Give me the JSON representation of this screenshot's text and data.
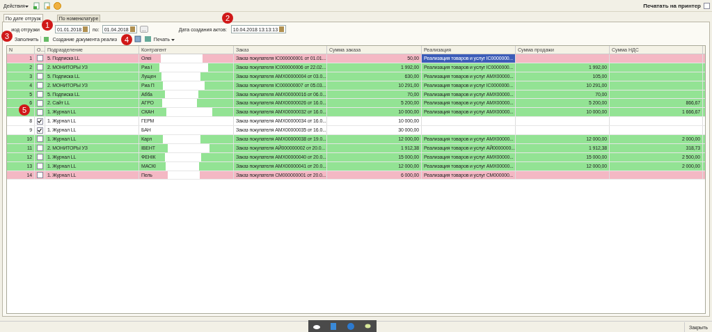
{
  "toolbar": {
    "menu": "Действия",
    "print_checkbox": {
      "label": "Печатать на принтер",
      "checked": false
    }
  },
  "tabs": [
    {
      "label": "По дате отгрузк",
      "selected": true
    },
    {
      "label": "По номенклатуре",
      "selected": false
    }
  ],
  "period": {
    "label": "иод отгрузки",
    "from": "01.01.2018",
    "to_label": "по:",
    "to": "01.04.2018",
    "button": "..."
  },
  "acts_date": {
    "label": "Дата создания актов:",
    "value": "10.04.2018 13:13:13"
  },
  "commands": [
    {
      "kind": "fill",
      "label": "Заполнить"
    },
    {
      "kind": "create",
      "label": "Создание документа реализ"
    },
    {
      "kind": "print",
      "label": "Печать"
    }
  ],
  "table": {
    "columns": [
      "N",
      "О...",
      "Подразделение",
      "Контрагент",
      "Заказ",
      "Сумма заказа",
      "Реализация",
      "Сумма продажи",
      "Сумма НДС"
    ],
    "rows": [
      {
        "n": "1",
        "checked": false,
        "selected": true,
        "color": "#f4b8c4",
        "division": "5. Подписка LL",
        "counterparty": "Олеі",
        "order": "Заказ покупателя IC000000001 от 01.01...",
        "order_sum": "50,00",
        "realization": "Реализация товаров и услуг IC0000000...",
        "sale_sum": "",
        "vat": ""
      },
      {
        "n": "2",
        "checked": false,
        "selected": false,
        "color": "#93e394",
        "division": "2. МОНИТОРЫ УЗ",
        "counterparty": "Риа І",
        "order": "Заказ покупателя IC000000006 от 22.02...",
        "order_sum": "1 992,00",
        "realization": "Реализация товаров и услуг IC0000000...",
        "sale_sum": "1 992,00",
        "vat": ""
      },
      {
        "n": "3",
        "checked": false,
        "selected": false,
        "color": "#93e394",
        "division": "5. Подписка LL",
        "counterparty": "Лущен",
        "order": "Заказ покупателя АМХ00000004 от 03.0...",
        "order_sum": "630,00",
        "realization": "Реализация товаров и услуг АМХ00000...",
        "sale_sum": "105,00",
        "vat": ""
      },
      {
        "n": "4",
        "checked": false,
        "selected": false,
        "color": "#93e394",
        "division": "2. МОНИТОРЫ УЗ",
        "counterparty": "Риа П",
        "order": "Заказ покупателя IC000000007 от 05.03...",
        "order_sum": "10 291,00",
        "realization": "Реализация товаров и услуг IC0000000...",
        "sale_sum": "10 291,00",
        "vat": ""
      },
      {
        "n": "5",
        "checked": false,
        "selected": false,
        "color": "#93e394",
        "division": "5. Подписка LL",
        "counterparty": "Абба",
        "order": "Заказ покупателя АМХ00000016 от 06.0...",
        "order_sum": "70,00",
        "realization": "Реализация товаров и услуг АМХ00000...",
        "sale_sum": "70,00",
        "vat": ""
      },
      {
        "n": "6",
        "checked": false,
        "selected": false,
        "color": "#93e394",
        "division": "2. Сайт LL",
        "counterparty": "АГРО",
        "order": "Заказ покупателя АМХ00000026 от 16.0...",
        "order_sum": "5 200,00",
        "realization": "Реализация товаров и услуг АМХ00000...",
        "sale_sum": "5 200,00",
        "vat": "866,67"
      },
      {
        "checked": false,
        "selected": false,
        "color": "#93e394",
        "division": "1. Журнал LL",
        "counterparty": "СКАН",
        "order": "Заказ покупателя АМХ00000032 от 16.0...",
        "order_sum": "10 000,00",
        "realization": "Реализация товаров и услуг АМХ00000...",
        "sale_sum": "10 000,00",
        "vat": "1 666,67"
      },
      {
        "n": "8",
        "checked": true,
        "selected": false,
        "color": "#ffffff",
        "division": "1. Журнал LL",
        "counterparty": "ГЕРМ",
        "order": "Заказ покупателя АМХ00000034 от 16.0...",
        "order_sum": "10 000,00",
        "realization": "",
        "sale_sum": "",
        "vat": ""
      },
      {
        "n": "9",
        "checked": true,
        "selected": false,
        "color": "#ffffff",
        "division": "1. Журнал LL",
        "counterparty": "БАН",
        "order": "Заказ покупателя АМХ00000035 от 16.0...",
        "order_sum": "30 000,00",
        "realization": "",
        "sale_sum": "",
        "vat": ""
      },
      {
        "n": "10",
        "checked": false,
        "selected": false,
        "color": "#93e394",
        "division": "1. Журнал LL",
        "counterparty": "Карл",
        "order": "Заказ покупателя АМХ00000038 от 19.0...",
        "order_sum": "12 000,00",
        "realization": "Реализация товаров и услуг АМХ00000...",
        "sale_sum": "12 000,00",
        "vat": "2 000,00"
      },
      {
        "n": "11",
        "checked": false,
        "selected": false,
        "color": "#93e394",
        "division": "2. МОНИТОРЫ УЗ",
        "counterparty": "ІВЕНТ",
        "order": "Заказ покупателя АЙ000000002 от 20.0...",
        "order_sum": "1 912,38",
        "realization": "Реализация товаров и услуг АЙ0000000...",
        "sale_sum": "1 912,38",
        "vat": "318,73"
      },
      {
        "n": "12",
        "checked": false,
        "selected": false,
        "color": "#93e394",
        "division": "1. Журнал LL",
        "counterparty": "ФЕНІК",
        "order": "Заказ покупателя АМХ00000040 от 20.0...",
        "order_sum": "15 000,00",
        "realization": "Реализация товаров и услуг АМХ00000...",
        "sale_sum": "15 000,00",
        "vat": "2 500,00"
      },
      {
        "n": "13",
        "checked": false,
        "selected": false,
        "color": "#93e394",
        "division": "1. Журнал LL",
        "counterparty": "МАСКІ",
        "order": "Заказ покупателя АМХ00000041 от 20.0...",
        "order_sum": "12 000,00",
        "realization": "Реализация товаров и услуг АМХ00000...",
        "sale_sum": "12 000,00",
        "vat": "2 000,00"
      },
      {
        "n": "14",
        "checked": false,
        "selected": false,
        "color": "#f4b8c4",
        "division": "1. Журнал LL",
        "counterparty": "Пель",
        "order": "Заказ покупателя СМ000000001 от 20.0...",
        "order_sum": "6 000,00",
        "realization": "Реализация товаров и услуг СМ000000...",
        "sale_sum": "",
        "vat": ""
      }
    ]
  },
  "annotations": [
    "1",
    "2",
    "3",
    "4",
    "5"
  ],
  "status_bar": {
    "close": "Закрыть"
  }
}
